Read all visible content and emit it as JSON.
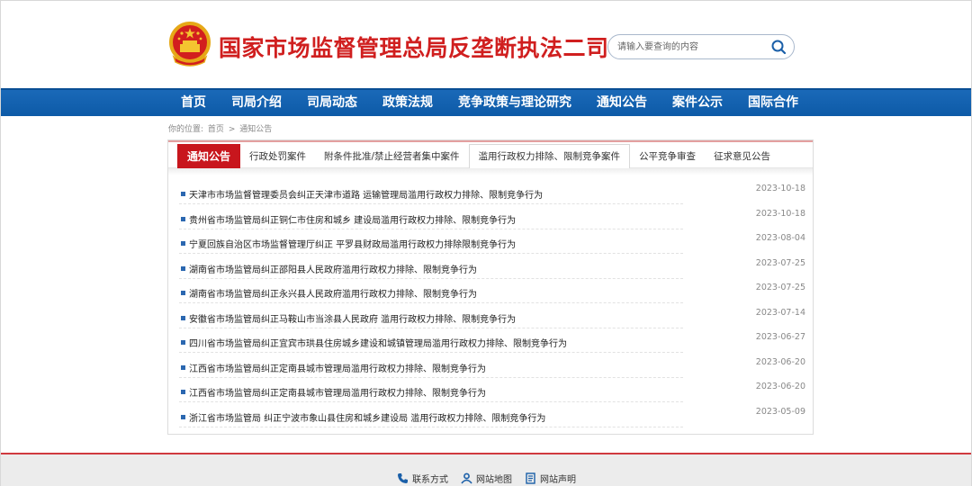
{
  "header": {
    "site_title": "国家市场监督管理总局反垄断执法二司",
    "search_placeholder": "请输入要查询的内容"
  },
  "nav": {
    "items": [
      "首页",
      "司局介绍",
      "司局动态",
      "政策法规",
      "竞争政策与理论研究",
      "通知公告",
      "案件公示",
      "国际合作"
    ]
  },
  "breadcrumb": {
    "prefix": "你的位置:",
    "home": "首页",
    "separator": ">",
    "current": "通知公告"
  },
  "tabs": {
    "section_label": "通知公告",
    "items": [
      "行政处罚案件",
      "附条件批准/禁止经营者集中案件",
      "滥用行政权力排除、限制竞争案件",
      "公平竞争审查",
      "征求意见公告"
    ],
    "selected_index": 2
  },
  "notices": [
    {
      "title": "天津市市场监督管理委员会纠正天津市道路 运输管理局滥用行政权力排除、限制竞争行为",
      "date": "2023-10-18"
    },
    {
      "title": "贵州省市场监管局纠正铜仁市住房和城乡 建设局滥用行政权力排除、限制竞争行为",
      "date": "2023-10-18"
    },
    {
      "title": "宁夏回族自治区市场监督管理厅纠正 平罗县财政局滥用行政权力排除限制竞争行为",
      "date": "2023-08-04"
    },
    {
      "title": "湖南省市场监管局纠正邵阳县人民政府滥用行政权力排除、限制竞争行为",
      "date": "2023-07-25"
    },
    {
      "title": "湖南省市场监管局纠正永兴县人民政府滥用行政权力排除、限制竞争行为",
      "date": "2023-07-25"
    },
    {
      "title": "安徽省市场监管局纠正马鞍山市当涂县人民政府 滥用行政权力排除、限制竞争行为",
      "date": "2023-07-14"
    },
    {
      "title": "四川省市场监管局纠正宜宾市珙县住房城乡建设和城镇管理局滥用行政权力排除、限制竞争行为",
      "date": "2023-06-27"
    },
    {
      "title": "江西省市场监管局纠正定南县城市管理局滥用行政权力排除、限制竞争行为",
      "date": "2023-06-20"
    },
    {
      "title": "江西省市场监管局纠正定南县城市管理局滥用行政权力排除、限制竞争行为",
      "date": "2023-06-20"
    },
    {
      "title": "浙江省市场监管局 纠正宁波市象山县住房和城乡建设局 滥用行政权力排除、限制竞争行为",
      "date": "2023-05-09"
    }
  ],
  "footer": {
    "links": [
      {
        "label": "联系方式",
        "icon": "phone-icon"
      },
      {
        "label": "网站地图",
        "icon": "sitemap-icon"
      },
      {
        "label": "网站声明",
        "icon": "document-icon"
      }
    ]
  },
  "colors": {
    "brand_red": "#c8161d",
    "nav_blue": "#1a69b8",
    "bullet_blue": "#2b67b0"
  }
}
